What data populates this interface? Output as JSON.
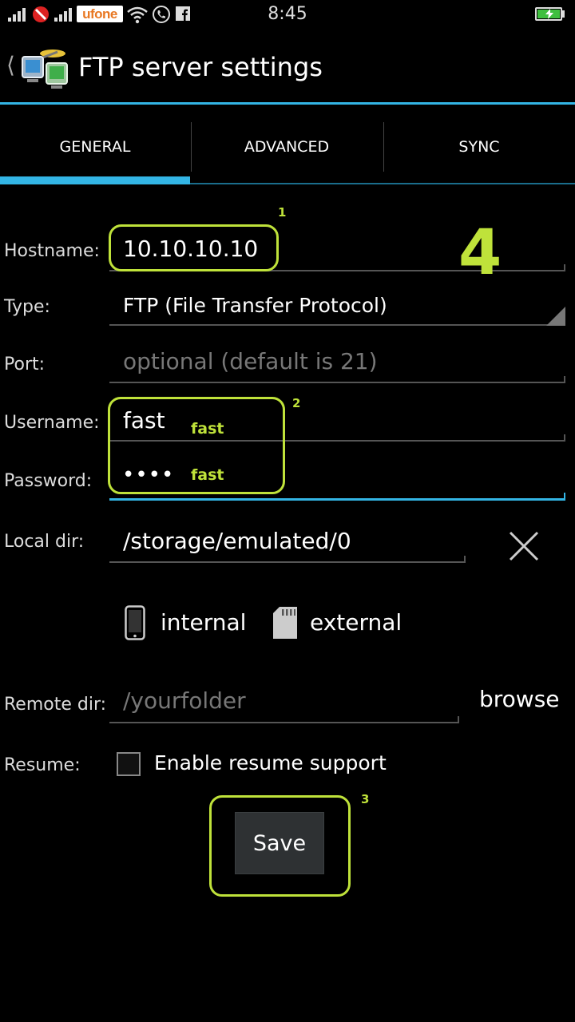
{
  "status_bar": {
    "carrier": "ufone",
    "time": "8:45",
    "icons": [
      "signal-icon",
      "blocked-icon",
      "wifi-icon",
      "phone-call-icon",
      "facebook-icon",
      "battery-charging-icon"
    ]
  },
  "action_bar": {
    "title": "FTP server settings",
    "back_icon": "chevron-left-icon",
    "app_icon": "ftp-network-icon"
  },
  "tabs": [
    {
      "label": "GENERAL",
      "selected": true
    },
    {
      "label": "ADVANCED",
      "selected": false
    },
    {
      "label": "SYNC",
      "selected": false
    }
  ],
  "form": {
    "hostname": {
      "label": "Hostname:",
      "value": "10.10.10.10"
    },
    "type": {
      "label": "Type:",
      "value": "FTP (File Transfer Protocol)"
    },
    "port": {
      "label": "Port:",
      "value": "",
      "placeholder": "optional (default is 21)"
    },
    "username": {
      "label": "Username:",
      "value": "fast"
    },
    "password": {
      "label": "Password:",
      "value": "••••"
    },
    "local_dir": {
      "label": "Local dir:",
      "value": "/storage/emulated/0"
    },
    "storage": {
      "internal_label": "internal",
      "external_label": "external"
    },
    "remote_dir": {
      "label": "Remote dir:",
      "value": "",
      "placeholder": "/yourfolder",
      "browse_label": "browse"
    },
    "resume": {
      "label": "Resume:",
      "checkbox_label": "Enable resume support",
      "checked": false
    },
    "save_label": "Save"
  },
  "annotations": {
    "box1_number": "1",
    "box2_number": "2",
    "box3_number": "3",
    "step_number": "4",
    "username_note": "fast",
    "password_note": "fast",
    "color": "#bfe23a"
  },
  "colors": {
    "accent": "#33b5e5",
    "background": "#000000",
    "annotation": "#bfe23a"
  }
}
